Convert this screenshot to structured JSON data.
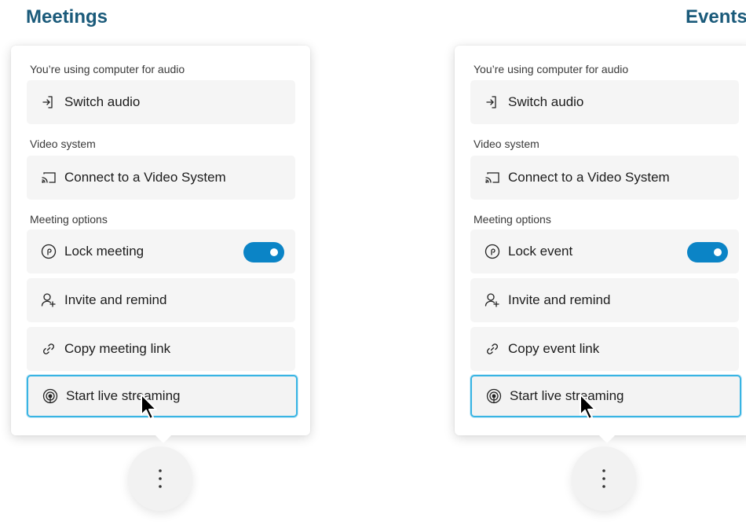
{
  "left": {
    "heading": "Meetings",
    "audio_label": "You’re using computer for audio",
    "switch_audio": "Switch audio",
    "video_label": "Video system",
    "connect_video": "Connect to a Video System",
    "options_label": "Meeting options",
    "lock": "Lock meeting",
    "lock_on": true,
    "invite": "Invite and remind",
    "copy_link": "Copy meeting link",
    "live_stream": "Start live streaming"
  },
  "right": {
    "heading": "Events",
    "audio_label": "You’re using computer for audio",
    "switch_audio": "Switch audio",
    "video_label": "Video system",
    "connect_video": "Connect to a Video System",
    "options_label": "Meeting options",
    "lock": "Lock event",
    "lock_on": true,
    "invite": "Invite and remind",
    "copy_link": "Copy event link",
    "live_stream": "Start live streaming"
  },
  "icons": {
    "switch_audio": "switch-audio-icon",
    "video_system": "screen-cast-icon",
    "lock": "lock-circle-icon",
    "invite": "person-add-icon",
    "copy_link": "link-icon",
    "live_stream": "broadcast-icon",
    "more": "more-vertical-icon"
  },
  "colors": {
    "heading": "#1a5a7a",
    "toggle_on": "#0b84c6",
    "selected_border": "#39b4e3"
  }
}
